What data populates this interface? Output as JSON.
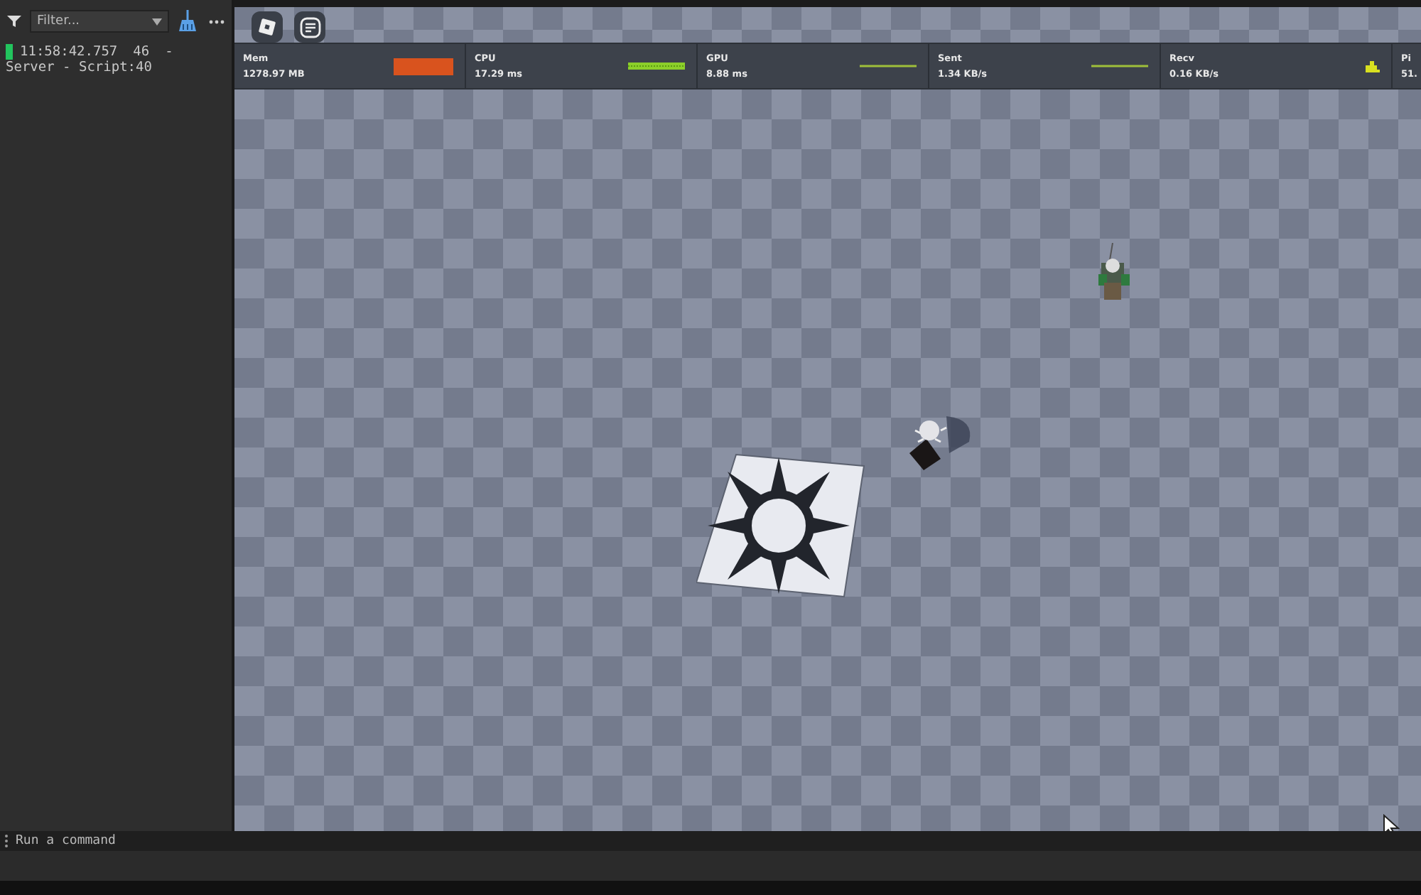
{
  "console": {
    "filter": {
      "placeholder": "Filter..."
    },
    "entries": [
      {
        "time": "11:58:42.757",
        "count": "46",
        "dash": "-",
        "source": "Server - Script:40",
        "color": "#22c55e"
      }
    ]
  },
  "viewport": {
    "stats": [
      {
        "label": "Mem",
        "value": "1278.97 MB",
        "kind": "bar"
      },
      {
        "label": "CPU",
        "value": "17.29 ms",
        "kind": "sparkline"
      },
      {
        "label": "GPU",
        "value": "8.88 ms",
        "kind": "line"
      },
      {
        "label": "Sent",
        "value": "1.34 KB/s",
        "kind": "line"
      },
      {
        "label": "Recv",
        "value": "0.16 KB/s",
        "kind": "blob"
      },
      {
        "label": "Pi",
        "value": "51."
      }
    ]
  },
  "command_bar": {
    "placeholder": "Run a command"
  }
}
